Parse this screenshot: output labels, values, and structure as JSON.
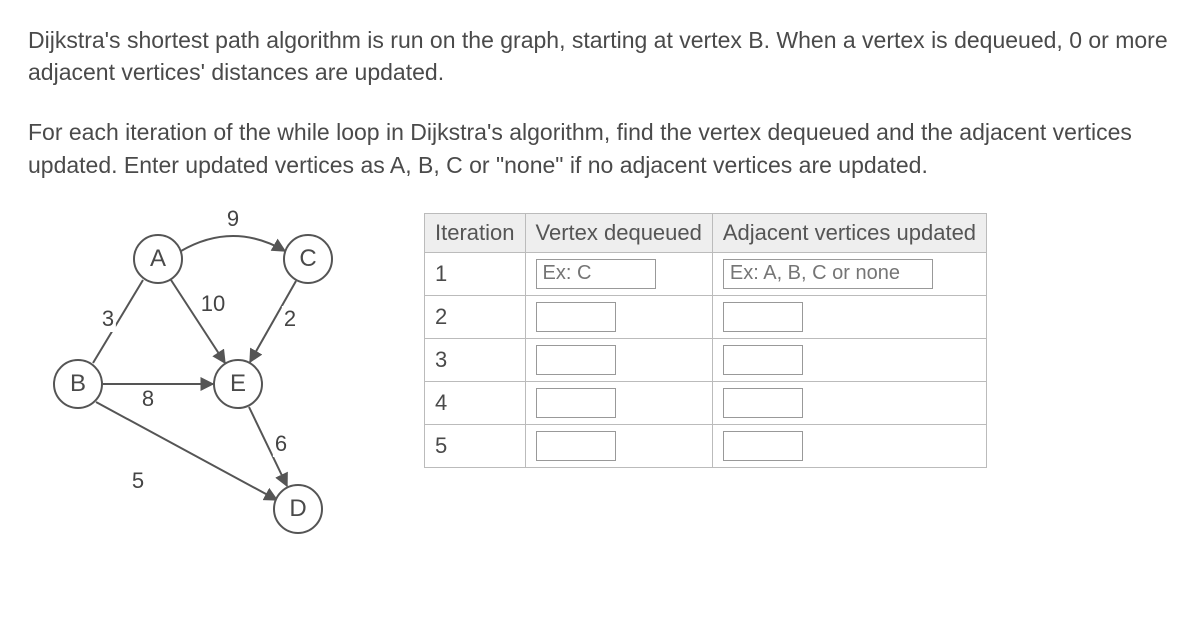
{
  "prompt": {
    "p1": "Dijkstra's shortest path algorithm is run on the graph, starting at vertex B. When a vertex is dequeued, 0 or more adjacent vertices' distances are updated.",
    "p2": "For each iteration of the while loop in Dijkstra's algorithm, find the vertex dequeued and the adjacent vertices updated. Enter updated vertices as A, B, C or \"none\" if no adjacent vertices are updated."
  },
  "graph": {
    "nodes": {
      "A": "A",
      "B": "B",
      "C": "C",
      "D": "D",
      "E": "E"
    },
    "weights": {
      "AC": "9",
      "AE": "10",
      "AB": "3",
      "CE": "2",
      "BE": "8",
      "BD": "5",
      "ED": "6"
    }
  },
  "table": {
    "headers": {
      "iter": "Iteration",
      "deq": "Vertex dequeued",
      "adj": "Adjacent vertices updated"
    },
    "rows": [
      {
        "iter": "1",
        "deq_ph": "Ex: C",
        "adj_ph": "Ex: A, B, C or none"
      },
      {
        "iter": "2",
        "deq_ph": "",
        "adj_ph": ""
      },
      {
        "iter": "3",
        "deq_ph": "",
        "adj_ph": ""
      },
      {
        "iter": "4",
        "deq_ph": "",
        "adj_ph": ""
      },
      {
        "iter": "5",
        "deq_ph": "",
        "adj_ph": ""
      }
    ]
  }
}
